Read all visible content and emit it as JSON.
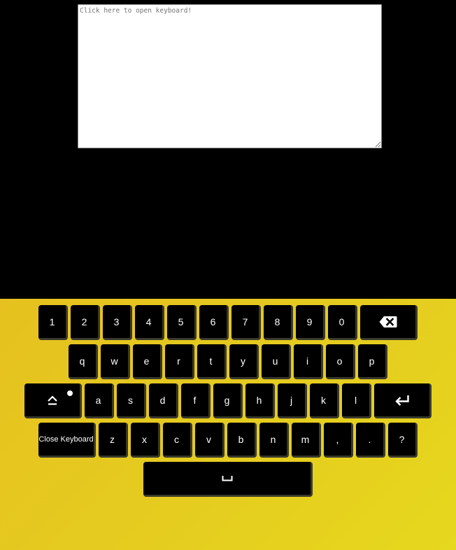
{
  "editor": {
    "placeholder": "Click here to open keyboard!",
    "value": ""
  },
  "keyboard": {
    "rows": [
      [
        "1",
        "2",
        "3",
        "4",
        "5",
        "6",
        "7",
        "8",
        "9",
        "0"
      ],
      [
        "q",
        "w",
        "e",
        "r",
        "t",
        "y",
        "u",
        "i",
        "o",
        "p"
      ],
      [
        "a",
        "s",
        "d",
        "f",
        "g",
        "h",
        "j",
        "k",
        "l"
      ],
      [
        "z",
        "x",
        "c",
        "v",
        "b",
        "n",
        "m",
        ",",
        ".",
        "?"
      ]
    ],
    "special": {
      "backspace_icon": "backspace-icon",
      "shift_icon": "shift-icon",
      "enter_icon": "enter-icon",
      "space_icon": "space-icon",
      "close_label": "Close Keyboard"
    }
  },
  "colors": {
    "keyboard_bg_start": "#e6c11f",
    "keyboard_bg_end": "#e6d81e",
    "key_bg": "#000000",
    "key_text": "#ffffff",
    "page_bg": "#000000"
  }
}
